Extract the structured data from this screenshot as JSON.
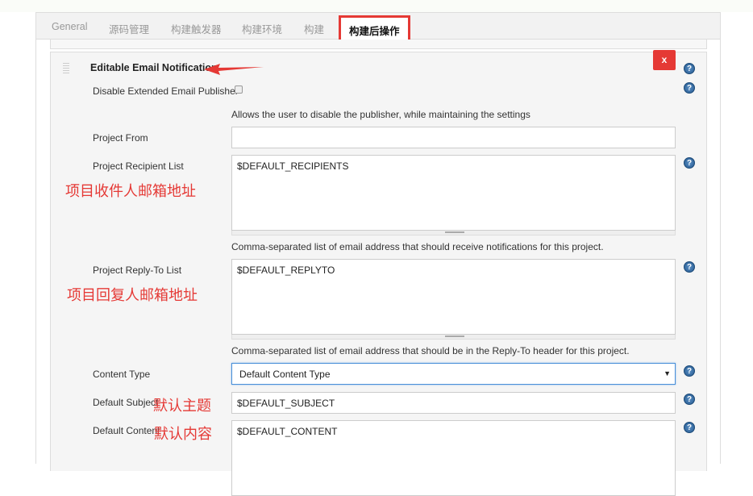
{
  "tabs": [
    {
      "label": "General"
    },
    {
      "label": "源码管理"
    },
    {
      "label": "构建触发器"
    },
    {
      "label": "构建环境"
    },
    {
      "label": "构建"
    },
    {
      "label": "构建后操作"
    }
  ],
  "section": {
    "title": "Editable Email Notification",
    "delete_label": "x"
  },
  "fields": {
    "disable_publisher": {
      "label": "Disable Extended Email Publisher",
      "checked": false,
      "description": "Allows the user to disable the publisher, while maintaining the settings"
    },
    "project_from": {
      "label": "Project From",
      "value": ""
    },
    "recipient_list": {
      "label": "Project Recipient List",
      "value": "$DEFAULT_RECIPIENTS",
      "description": "Comma-separated list of email address that should receive notifications for this project.",
      "annotation": "项目收件人邮箱地址"
    },
    "reply_to": {
      "label": "Project Reply-To List",
      "value": "$DEFAULT_REPLYTO",
      "description": "Comma-separated list of email address that should be in the Reply-To header for this project.",
      "annotation": "项目回复人邮箱地址"
    },
    "content_type": {
      "label": "Content Type",
      "value": "Default Content Type"
    },
    "default_subject": {
      "label": "Default Subject",
      "value": "$DEFAULT_SUBJECT",
      "annotation": "默认主题"
    },
    "default_content": {
      "label": "Default Content",
      "value": "$DEFAULT_CONTENT",
      "annotation": "默认内容"
    }
  },
  "colors": {
    "accent": "#e53935",
    "help": "#25598f"
  },
  "help_label": "?"
}
